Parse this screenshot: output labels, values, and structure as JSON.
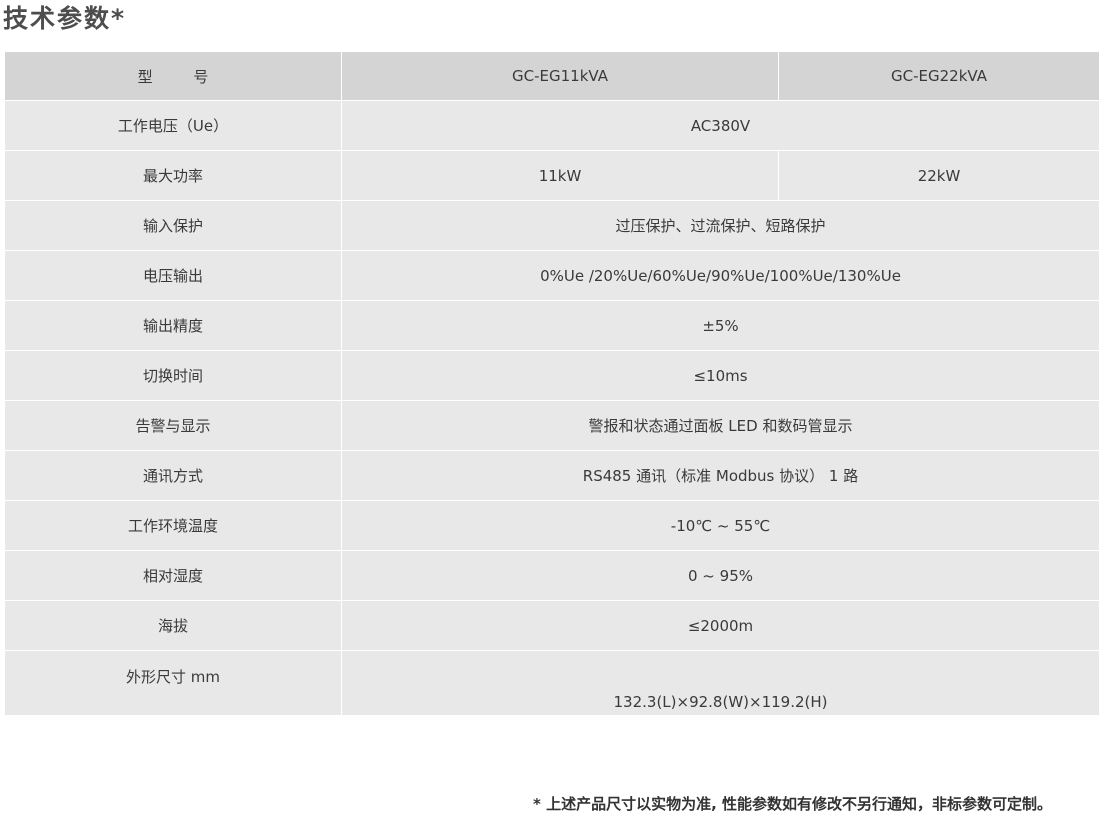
{
  "page": {
    "title": "技术参数*",
    "footnote": "* 上述产品尺寸以实物为准, 性能参数如有修改不另行通知，非标参数可定制。"
  },
  "table": {
    "header": {
      "label": "型 号",
      "model_a": "GC-EG11kVA",
      "model_b": "GC-EG22kVA"
    },
    "rows": [
      {
        "label": "工作电压（Ue）",
        "value": "AC380V"
      },
      {
        "label": "最大功率",
        "value_a": "11kW",
        "value_b": "22kW"
      },
      {
        "label": "输入保护",
        "value": "过压保护、过流保护、短路保护"
      },
      {
        "label": "电压输出",
        "value": "0%Ue /20%Ue/60%Ue/90%Ue/100%Ue/130%Ue"
      },
      {
        "label": "输出精度",
        "value": "±5%"
      },
      {
        "label": "切换时间",
        "value": "≤10ms"
      },
      {
        "label": "告警与显示",
        "value": "警报和状态通过面板 LED 和数码管显示"
      },
      {
        "label": "通讯方式",
        "value": "RS485 通讯（标准 Modbus 协议） 1 路"
      },
      {
        "label": "工作环境温度",
        "value": "-10℃ ~ 55℃"
      },
      {
        "label": "相对湿度",
        "value": "0 ~ 95%"
      },
      {
        "label": "海拔",
        "value": "≤2000m"
      },
      {
        "label": "外形尺寸 mm",
        "value": "132.3(L)×92.8(W)×119.2(H)"
      }
    ]
  }
}
